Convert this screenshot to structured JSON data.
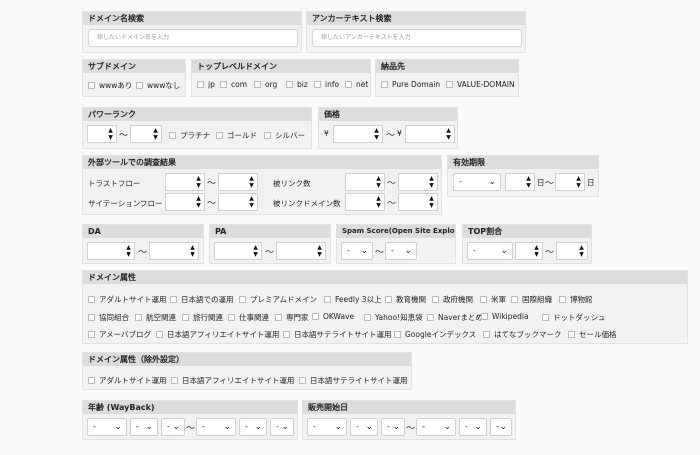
{
  "domain_search": {
    "title": "ドメイン名検索",
    "placeholder": "探したいドメイン名を入力"
  },
  "anchor_search": {
    "title": "アンカーテキスト検索",
    "placeholder": "探したいアンカーテキストを入力"
  },
  "subdomain": {
    "title": "サブドメイン",
    "options": [
      "wwwあり",
      "wwwなし"
    ]
  },
  "tld": {
    "title": "トップレベルドメイン",
    "options": [
      "jp",
      "com",
      "org",
      "biz",
      "info",
      "net"
    ]
  },
  "delivery": {
    "title": "納品先",
    "options": [
      "Pure Domain",
      "VALUE-DOMAIN"
    ]
  },
  "power_rank": {
    "title": "パワーランク",
    "tilde": "〜",
    "options": [
      "プラチナ",
      "ゴールド",
      "シルバー"
    ]
  },
  "price": {
    "title": "価格",
    "yen": "¥",
    "tilde": "〜"
  },
  "external_tools": {
    "title": "外部ツールでの調査結果",
    "trust_flow": "トラストフロー",
    "citation_flow": "サイテーションフロー",
    "backlinks": "被リンク数",
    "backlink_domains": "被リンクドメイン数",
    "tilde": "〜"
  },
  "expiry": {
    "title": "有効期限",
    "select": "-",
    "day": "日",
    "tilde": "〜"
  },
  "da": {
    "title": "DA",
    "tilde": "〜"
  },
  "pa": {
    "title": "PA",
    "tilde": "〜"
  },
  "spam": {
    "title": "Spam Score(Open Site Explorer)",
    "select": "-",
    "tilde": "〜"
  },
  "top": {
    "title": "TOP割合",
    "select": "-",
    "tilde": "〜"
  },
  "attributes": {
    "title": "ドメイン属性",
    "row1": [
      "アダルトサイト運用",
      "日本語での運用",
      "プレミアムドメイン",
      "Feedly 3以上",
      "教育機関",
      "政府機関",
      "米軍",
      "国際組織",
      "博物館"
    ],
    "row2": [
      "協同組合",
      "航空関連",
      "旅行関連",
      "仕事関連",
      "専門家",
      "OKWave",
      "Yahoo!知恵袋",
      "Naverまとめ",
      "Wikipedia",
      "ドットダッシュ"
    ],
    "row3": [
      "アメーバブログ",
      "日本語アフィリエイトサイト運用",
      "日本語サテライトサイト運用",
      "Googleインデックス",
      "はてなブックマーク",
      "セール価格"
    ]
  },
  "exclude": {
    "title": "ドメイン属性（除外設定）",
    "options": [
      "アダルトサイト運用",
      "日本語アフィリエイトサイト運用",
      "日本語サテライトサイト運用"
    ]
  },
  "age": {
    "title": "年齢 (WayBack)",
    "select": "-",
    "tilde": "〜"
  },
  "sale_start": {
    "title": "販売開始日",
    "select": "-",
    "tilde": "〜"
  }
}
